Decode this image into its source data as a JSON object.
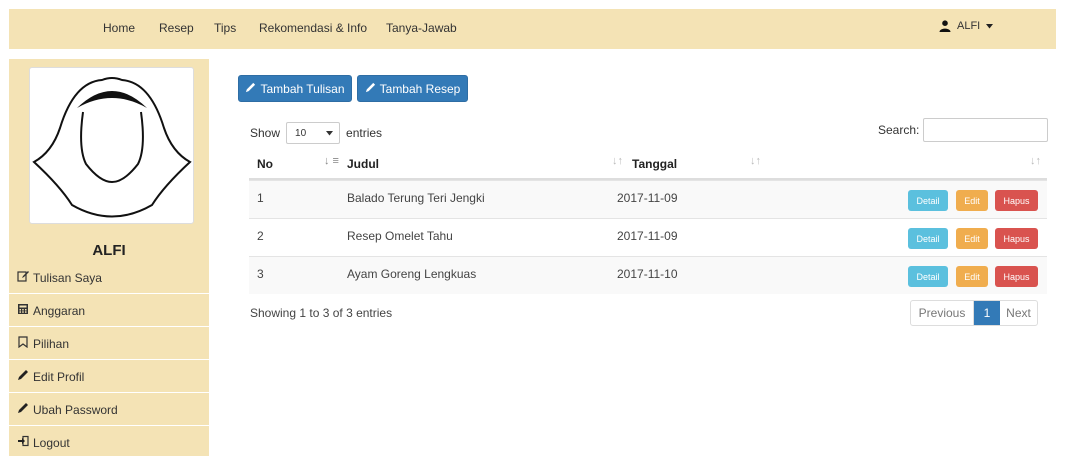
{
  "nav": {
    "links": [
      "Home",
      "Resep",
      "Tips",
      "Rekomendasi & Info",
      "Tanya-Jawab"
    ],
    "user": "ALFI"
  },
  "sidebar": {
    "username": "ALFI",
    "items": [
      {
        "label": "Tulisan Saya",
        "icon": "edit-icon"
      },
      {
        "label": "Anggaran",
        "icon": "calculator-icon"
      },
      {
        "label": "Pilihan",
        "icon": "bookmark-icon"
      },
      {
        "label": "Edit Profil",
        "icon": "pencil-icon"
      },
      {
        "label": "Ubah Password",
        "icon": "pencil-icon"
      },
      {
        "label": "Logout",
        "icon": "logout-icon"
      }
    ]
  },
  "actions": {
    "tambah_tulisan": "Tambah Tulisan",
    "tambah_resep": "Tambah Resep"
  },
  "table_controls": {
    "show_label": "Show",
    "entries_label": "entries",
    "page_length": "10",
    "search_label": "Search:",
    "search_value": ""
  },
  "table": {
    "columns": [
      "No",
      "Judul",
      "Tanggal"
    ],
    "rows": [
      {
        "no": "1",
        "judul": "Balado Terung Teri Jengki",
        "tanggal": "2017-11-09"
      },
      {
        "no": "2",
        "judul": "Resep Omelet Tahu",
        "tanggal": "2017-11-09"
      },
      {
        "no": "3",
        "judul": "Ayam Goreng Lengkuas",
        "tanggal": "2017-11-10"
      }
    ],
    "row_actions": {
      "detail": "Detail",
      "edit": "Edit",
      "hapus": "Hapus"
    }
  },
  "footer": {
    "info": "Showing 1 to 3 of 3 entries",
    "previous": "Previous",
    "current_page": "1",
    "next": "Next"
  },
  "colors": {
    "nav_bg": "#f4e3b5",
    "primary": "#337ab7",
    "info": "#5bc0de",
    "warning": "#f0ad4e",
    "danger": "#d9534f"
  }
}
